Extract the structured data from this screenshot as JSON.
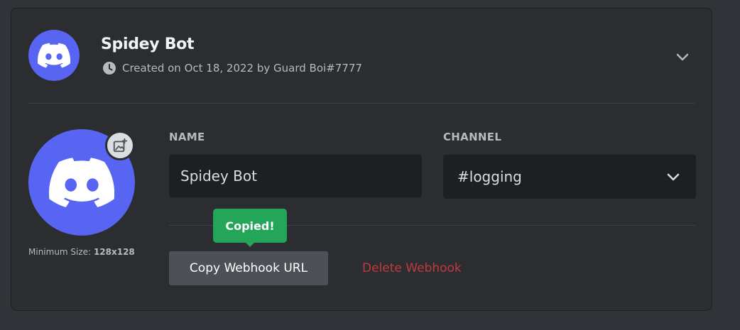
{
  "webhook": {
    "title": "Spidey Bot",
    "created_text": "Created on Oct 18, 2022 by Guard Boi#7777"
  },
  "avatar": {
    "min_size_label": "Minimum Size:",
    "min_size_value": "128x128"
  },
  "form": {
    "name_label": "NAME",
    "name_value": "Spidey Bot",
    "channel_label": "CHANNEL",
    "channel_value": "#logging"
  },
  "actions": {
    "tooltip_text": "Copied!",
    "copy_label": "Copy Webhook URL",
    "delete_label": "Delete Webhook"
  },
  "colors": {
    "blurple": "#5865f2",
    "success": "#23a55a",
    "danger": "#f23f42"
  },
  "icons": {
    "avatar": "discord-logo-icon",
    "clock": "clock-icon",
    "expand": "chevron-down-icon",
    "upload": "image-add-icon",
    "dropdown": "chevron-down-icon"
  }
}
